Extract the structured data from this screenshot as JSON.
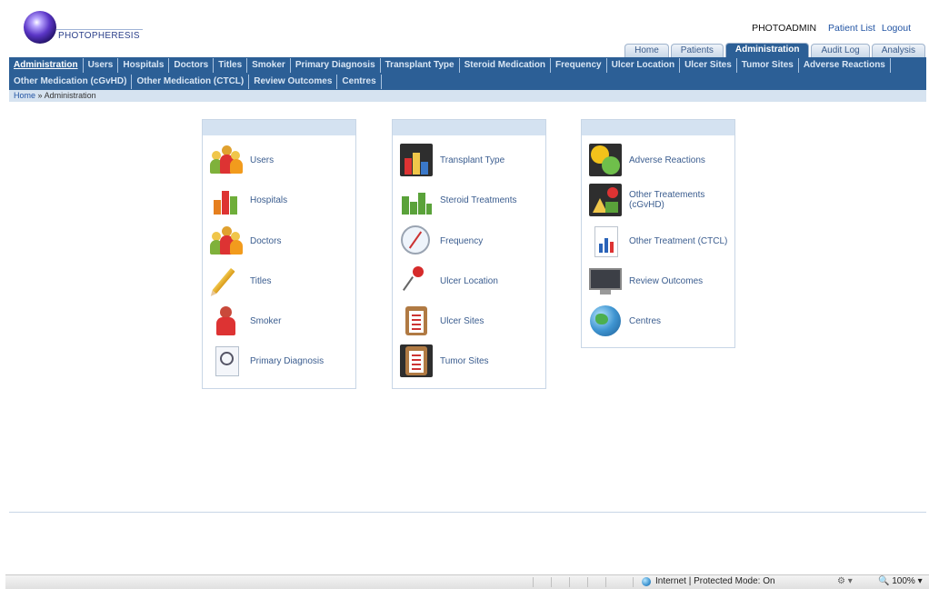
{
  "header": {
    "logo_text": "PHOTOPHERESIS",
    "user_name": "PHOTOADMIN",
    "patient_list_link": "Patient List",
    "logout_link": "Logout"
  },
  "main_tabs": [
    {
      "label": "Home"
    },
    {
      "label": "Patients"
    },
    {
      "label": "Administration",
      "active": true
    },
    {
      "label": "Audit Log"
    },
    {
      "label": "Analysis"
    }
  ],
  "subnav": {
    "row1": [
      "Administration",
      "Users",
      "Hospitals",
      "Doctors",
      "Titles",
      "Smoker",
      "Primary Diagnosis",
      "Transplant Type",
      "Steroid Medication",
      "Frequency",
      "Ulcer Location",
      "Ulcer Sites",
      "Tumor Sites",
      "Adverse Reactions"
    ],
    "row2": [
      "Other Medication (cGvHD)",
      "Other Medication (CTCL)",
      "Review Outcomes",
      "Centres"
    ]
  },
  "breadcrumb": {
    "home": "Home",
    "separator": "»",
    "current": "Administration"
  },
  "panels": [
    {
      "items": [
        {
          "label": "Users",
          "icon": "users-icon"
        },
        {
          "label": "Hospitals",
          "icon": "hospitals-icon"
        },
        {
          "label": "Doctors",
          "icon": "doctors-icon"
        },
        {
          "label": "Titles",
          "icon": "pencil-icon"
        },
        {
          "label": "Smoker",
          "icon": "person-icon"
        },
        {
          "label": "Primary Diagnosis",
          "icon": "diagnosis-icon"
        }
      ]
    },
    {
      "items": [
        {
          "label": "Transplant Type",
          "icon": "bar-chart-icon"
        },
        {
          "label": "Steroid Treatments",
          "icon": "steroid-chart-icon"
        },
        {
          "label": "Frequency",
          "icon": "compass-icon"
        },
        {
          "label": "Ulcer Location",
          "icon": "pushpin-icon"
        },
        {
          "label": "Ulcer Sites",
          "icon": "clipboard-icon"
        },
        {
          "label": "Tumor Sites",
          "icon": "clipboard-icon"
        }
      ]
    },
    {
      "items": [
        {
          "label": "Adverse Reactions",
          "icon": "faces-icon"
        },
        {
          "label": "Other Treatements (cGvHD)",
          "icon": "treatment-chart-icon"
        },
        {
          "label": "Other Treatment (CTCL)",
          "icon": "ctcl-chart-icon"
        },
        {
          "label": "Review Outcomes",
          "icon": "monitor-icon"
        },
        {
          "label": "Centres",
          "icon": "globe-icon"
        }
      ]
    }
  ],
  "statusbar": {
    "zone_text": "Internet | Protected Mode: On",
    "zoom_text": "100%"
  },
  "colors": {
    "nav_blue": "#2c5f96",
    "panel_header": "#d4e2f1",
    "link_blue": "#3b5d8f"
  }
}
